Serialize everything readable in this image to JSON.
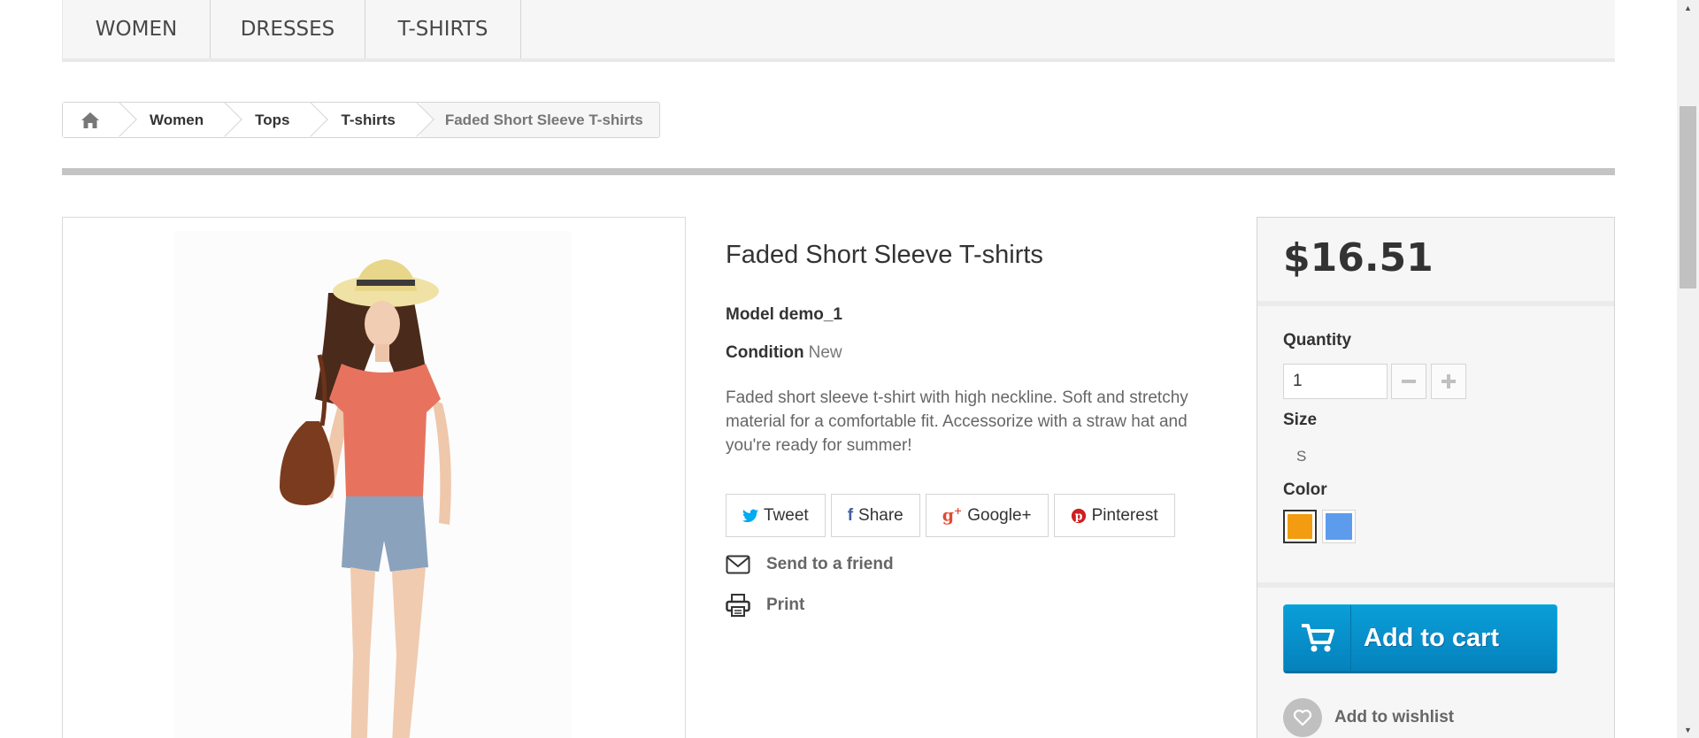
{
  "menu": {
    "items": [
      {
        "label": "WOMEN"
      },
      {
        "label": "DRESSES"
      },
      {
        "label": "T-SHIRTS"
      }
    ]
  },
  "breadcrumb": {
    "home_icon": "home-icon",
    "items": [
      {
        "label": "Women"
      },
      {
        "label": "Tops"
      },
      {
        "label": "T-shirts"
      }
    ],
    "current": "Faded Short Sleeve T-shirts"
  },
  "product": {
    "title": "Faded Short Sleeve T-shirts",
    "model_label": "Model",
    "model_value": "demo_1",
    "condition_label": "Condition",
    "condition_value": "New",
    "description": "Faded short sleeve t-shirt with high neckline. Soft and stretchy material for a comfortable fit. Accessorize with a straw hat and you're ready for summer!"
  },
  "social": [
    {
      "label": "Tweet",
      "icon": "twitter-icon",
      "color": "#00aaf0"
    },
    {
      "label": "Share",
      "icon": "facebook-icon",
      "color": "#435f9f"
    },
    {
      "label": "Google+",
      "icon": "googleplus-icon",
      "color": "#e04b34"
    },
    {
      "label": "Pinterest",
      "icon": "pinterest-icon",
      "color": "#ce1f21"
    }
  ],
  "actions": {
    "send_friend": "Send to a friend",
    "print": "Print"
  },
  "buy": {
    "price": "$16.51",
    "quantity_label": "Quantity",
    "quantity_value": "1",
    "size_label": "Size",
    "size_value": "S",
    "color_label": "Color",
    "colors": [
      {
        "hex": "#f39c11",
        "selected": true
      },
      {
        "hex": "#5d9cec",
        "selected": false
      }
    ],
    "add_to_cart": "Add to cart",
    "add_to_wishlist": "Add to wishlist"
  },
  "theme": {
    "accent": "#0a9ed8",
    "border": "#d6d4d4",
    "panel": "#f6f6f6"
  }
}
